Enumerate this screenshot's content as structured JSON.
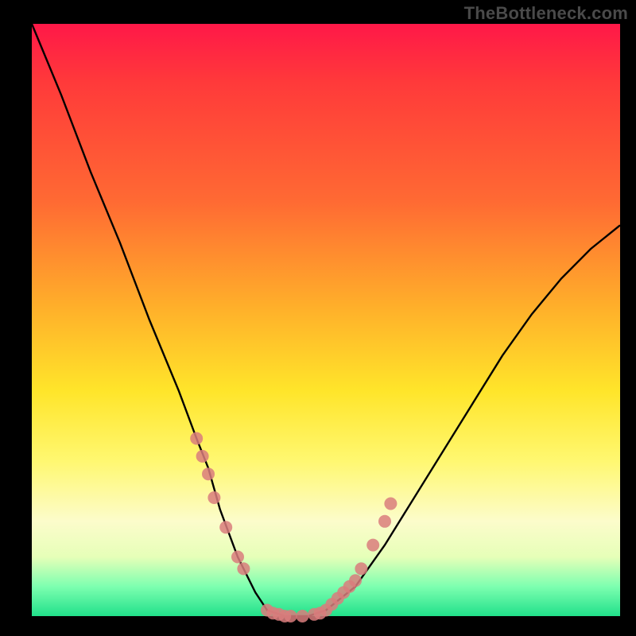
{
  "watermark": "TheBottleneck.com",
  "chart_data": {
    "type": "line",
    "title": "",
    "xlabel": "",
    "ylabel": "",
    "xlim": [
      0,
      100
    ],
    "ylim": [
      0,
      100
    ],
    "series": [
      {
        "name": "bottleneck-curve",
        "x": [
          0,
          5,
          10,
          15,
          20,
          25,
          28,
          30,
          32,
          35,
          38,
          40,
          43,
          47,
          50,
          55,
          60,
          65,
          70,
          75,
          80,
          85,
          90,
          95,
          100
        ],
        "y": [
          100,
          88,
          75,
          63,
          50,
          38,
          30,
          25,
          18,
          10,
          4,
          1,
          0,
          0,
          1,
          5,
          12,
          20,
          28,
          36,
          44,
          51,
          57,
          62,
          66
        ]
      }
    ],
    "markers": {
      "name": "data-points",
      "x": [
        28,
        29,
        30,
        31,
        33,
        35,
        36,
        40,
        41,
        42,
        43,
        44,
        46,
        48,
        49,
        50,
        51,
        52,
        53,
        54,
        55,
        56,
        58,
        60,
        61
      ],
      "y": [
        30,
        27,
        24,
        20,
        15,
        10,
        8,
        1,
        0.5,
        0.3,
        0,
        0,
        0,
        0.3,
        0.5,
        1,
        2,
        3,
        4,
        5,
        6,
        8,
        12,
        16,
        19
      ]
    },
    "gradient_stops": [
      {
        "pos": 0,
        "color": "#ff1848"
      },
      {
        "pos": 30,
        "color": "#ff6a33"
      },
      {
        "pos": 62,
        "color": "#ffe52a"
      },
      {
        "pos": 90,
        "color": "#e6ffb8"
      },
      {
        "pos": 100,
        "color": "#21e08a"
      }
    ],
    "marker_color": "#d97c7c",
    "line_color": "#000000"
  }
}
